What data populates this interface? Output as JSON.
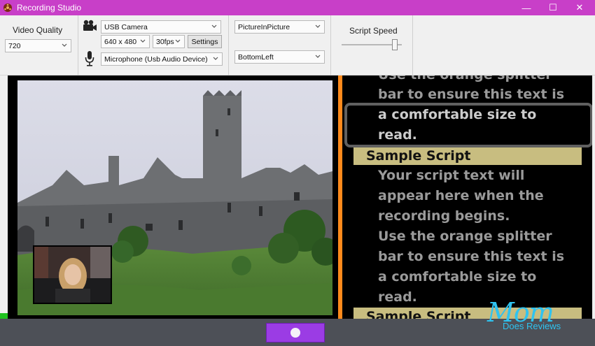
{
  "window": {
    "title": "Recording Studio",
    "minimize_glyph": "—",
    "maximize_glyph": "☐",
    "close_glyph": "✕"
  },
  "toolbar": {
    "video_quality": {
      "label": "Video Quality",
      "value": "720"
    },
    "camera": {
      "value": "USB Camera",
      "resolution": "640 x 480",
      "fps": "30fps",
      "settings_label": "Settings"
    },
    "microphone": {
      "value": "Microphone (Usb Audio Device)"
    },
    "layout": {
      "mode": "PictureInPicture",
      "position": "BottomLeft"
    },
    "script_speed": {
      "label": "Script Speed",
      "level": 0.88
    }
  },
  "script": {
    "lines_top": [
      "Use the orange splitter",
      "bar to ensure this text is"
    ],
    "focus_lines": [
      "a comfortable size to",
      "read."
    ],
    "heading": "Sample Script",
    "body_lines": [
      "Your script text will",
      "appear here when the",
      "recording begins.",
      "Use the orange splitter",
      "bar to ensure this text is",
      "a comfortable size to",
      "read."
    ],
    "heading_bottom": "Sample Script"
  },
  "watermark": {
    "main": "Mom",
    "sub": "Does Reviews"
  },
  "colors": {
    "titlebar": "#c83fc8",
    "splitter": "#ff8a1c",
    "record_button": "#9b3ce4",
    "script_heading_bg": "#c8bd80",
    "watermark": "#2fc3f0"
  },
  "icons": {
    "app": "film-reel-icon",
    "camera": "movie-camera-icon",
    "microphone": "microphone-icon",
    "record": "record-dot-icon"
  }
}
